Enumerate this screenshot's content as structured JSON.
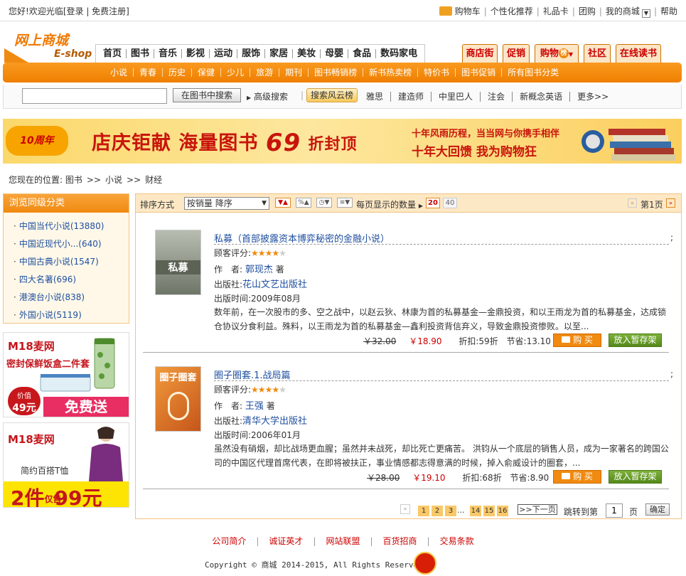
{
  "topbar": {
    "welcome": "您好!欢迎光临",
    "login": "[登录",
    "register": "免费注册]",
    "links": [
      "购物车",
      "个性化推荐",
      "礼品卡",
      "团购",
      "我的商城",
      "帮助"
    ]
  },
  "logo": {
    "cn": "网上商城",
    "en": "E-shop"
  },
  "nav": {
    "categories": [
      "首页",
      "图书",
      "音乐",
      "影视",
      "运动",
      "服饰",
      "家居",
      "美妆",
      "母婴",
      "食品",
      "数码家电"
    ],
    "right_tabs": [
      "商店街",
      "促销",
      "购物",
      "社区",
      "在线读书"
    ],
    "hot_badge": "榜"
  },
  "subnav": [
    "小说",
    "青春",
    "历史",
    "保健",
    "少儿",
    "旅游",
    "期刊",
    "图书畅销榜",
    "新书热卖榜",
    "特价书",
    "图书促销",
    "所有图书分类"
  ],
  "search": {
    "value": "",
    "button": "在图书中搜索",
    "advanced": "高级搜索",
    "hot_label": "搜索风云榜",
    "hot_keys": [
      "雅思",
      "建造师",
      "中里巴人",
      "注会",
      "新概念英语",
      "更多>>"
    ]
  },
  "banner": {
    "logo_text": "10周年",
    "main1": "店庆钜献  海量图书",
    "num": "69",
    "main2": "折封顶",
    "right1": "十年风雨历程，当当网与你携手相伴",
    "right2": "十年大回馈  我为购物狂"
  },
  "breadcrumb": {
    "prefix": "您现在的位置:",
    "items": [
      "图书",
      "小说",
      "财经"
    ]
  },
  "sidebar": {
    "title": "浏览同级分类",
    "items": [
      {
        "name": "中国当代小说",
        "count": "(13880)"
      },
      {
        "name": "中国近现代小...",
        "count": "(640)"
      },
      {
        "name": "中国古典小说",
        "count": "(1547)"
      },
      {
        "name": "四大名著",
        "count": "(696)"
      },
      {
        "name": "港澳台小说",
        "count": "(838)"
      },
      {
        "name": "外国小说",
        "count": "(5119)"
      }
    ]
  },
  "ads": [
    {
      "brand": "M18麦网",
      "headline": "密封保鲜饭盒二件套",
      "price_label": "价值",
      "price": "49元",
      "cta": "免费送"
    },
    {
      "brand": "M18麦网",
      "headline": "简约百搭T恤",
      "deal": "2件",
      "deal_small": "仅售",
      "deal_price": "99元"
    }
  ],
  "toolbar": {
    "sort_label": "排序方式",
    "sort_value": "按销量 降序",
    "per_page_label": "每页显示的数量",
    "per_page_options": [
      "20",
      "40"
    ],
    "page_label": "第1页"
  },
  "books": [
    {
      "title": "私募（首部披露资本博弈秘密的金融小说）",
      "rating_label": "顾客评分:",
      "rating": 4,
      "author_label": "作　者:",
      "author": "郭现杰",
      "author_suffix": "著",
      "publisher_label": "出版社:",
      "publisher": "花山文艺出版社",
      "date_label": "出版时间:",
      "date": "2009年08月",
      "desc": "数年前，在一次股市的多、空之战中，以赵云狄、林康为首的私募基金—金鼎投资，和以王雨龙为首的私募基金，达成锁仓协议分食利益。殊料，以王雨龙为首的私募基金—鑫利投资背信弃义，导致金鼎投资惨败。以至...",
      "orig_price": "￥32.00",
      "price": "￥18.90",
      "discount": "折扣:59折",
      "save": "节省:13.10",
      "buy": "购 买",
      "fav": "放入暂存架",
      "cover_title": "私募",
      "cover_color": "#8d9487"
    },
    {
      "title": "圈子圈套.1.战局篇",
      "rating_label": "顾客评分:",
      "rating": 4,
      "author_label": "作　者:",
      "author": "王强",
      "author_suffix": "著",
      "publisher_label": "出版社:",
      "publisher": "清华大学出版社",
      "date_label": "出版时间:",
      "date": "2006年01月",
      "desc": "虽然没有硝烟，却比战场更血腥；虽然并未战死，却比死亡更痛苦。 洪钧从一个底层的销售人员，成为一家著名的跨国公司的中国区代理首席代表，在即将被扶正，事业情感都志得意满的时候，掉入俞威设计的圈套，...",
      "orig_price": "￥28.00",
      "price": "￥19.10",
      "discount": "折扣:68折",
      "save": "节省:8.90",
      "buy": "购 买",
      "fav": "放入暂存架",
      "cover_title": "圈子圈套",
      "cover_color": "#e07a1a"
    }
  ],
  "pager": {
    "pages_a": [
      "1",
      "2",
      "3"
    ],
    "dots": "...",
    "pages_b": [
      "14",
      "15",
      "16"
    ],
    "next": ">>下一页",
    "jump_label": "跳转到第",
    "jump_value": "1",
    "page_unit": "页",
    "ok": "确定"
  },
  "footer": {
    "links": [
      "公司简介",
      "诚证英才",
      "网站联盟",
      "百货招商",
      "交易条款"
    ],
    "copyright": "Copyright © 商城 2014-2015, All Rights Reserved"
  }
}
